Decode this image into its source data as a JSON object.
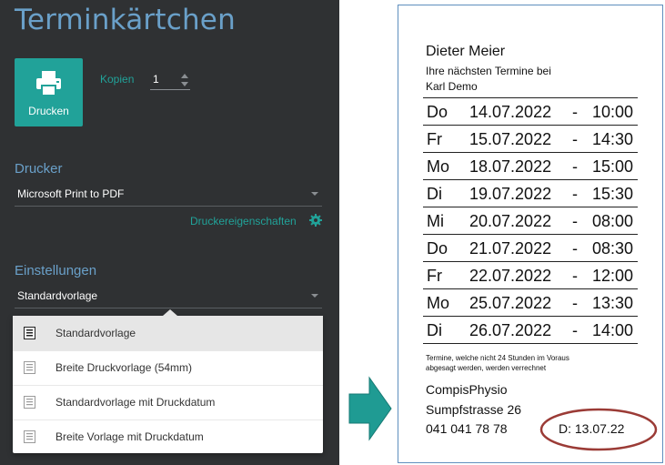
{
  "app": {
    "title": "Terminkärtchen"
  },
  "print": {
    "button_label": "Drucken",
    "copies_label": "Kopien",
    "copies_value": "1"
  },
  "printer": {
    "section_label": "Drucker",
    "selected": "Microsoft Print to PDF",
    "properties_link": "Druckereigenschaften"
  },
  "settings": {
    "section_label": "Einstellungen",
    "selected": "Standardvorlage",
    "options": [
      "Standardvorlage",
      "Breite Druckvorlage (54mm)",
      "Standardvorlage mit Druckdatum",
      "Breite Vorlage mit Druckdatum"
    ]
  },
  "card": {
    "name": "Dieter Meier",
    "subtitle1": "Ihre nächsten Termine bei",
    "subtitle2": "Karl Demo",
    "appointments": [
      {
        "day": "Do",
        "date": "14.07.2022",
        "time": "10:00"
      },
      {
        "day": "Fr",
        "date": "15.07.2022",
        "time": "14:30"
      },
      {
        "day": "Mo",
        "date": "18.07.2022",
        "time": "15:00"
      },
      {
        "day": "Di",
        "date": "19.07.2022",
        "time": "15:30"
      },
      {
        "day": "Mi",
        "date": "20.07.2022",
        "time": "08:00"
      },
      {
        "day": "Do",
        "date": "21.07.2022",
        "time": "08:30"
      },
      {
        "day": "Fr",
        "date": "22.07.2022",
        "time": "12:00"
      },
      {
        "day": "Mo",
        "date": "25.07.2022",
        "time": "13:30"
      },
      {
        "day": "Di",
        "date": "26.07.2022",
        "time": "14:00"
      }
    ],
    "separator": "-",
    "note_line1": "Termine, welche nicht 24 Stunden im Voraus",
    "note_line2": "abgesagt werden, werden verrechnet",
    "company": "CompisPhysio",
    "street": "Sumpfstrasse 26",
    "phone": "041 041 78 78",
    "print_date": "D: 13.07.22"
  },
  "icons": {
    "print": "printer-icon",
    "gear": "gear-icon",
    "template": "document-icon",
    "arrow": "arrow-right-icon"
  },
  "colors": {
    "panel_bg": "#2f3133",
    "title": "#6aa0c9",
    "accent": "#21a299",
    "highlight_ellipse": "#9b3b36"
  }
}
